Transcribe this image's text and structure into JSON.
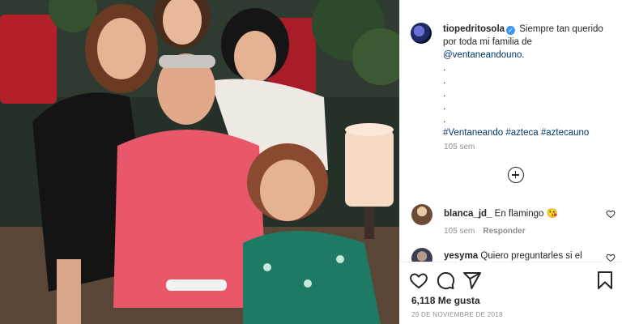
{
  "post": {
    "username": "tiopedritosola",
    "verified_mark": "✓",
    "caption_text": "Siempre tan querido por toda mi familia de",
    "mention": "@ventaneandouno.",
    "dots": [
      ".",
      ".",
      ".",
      ".",
      "."
    ],
    "hashtags": "#Ventaneando #azteca #aztecauno",
    "time_ago": "105 sem"
  },
  "comments": [
    {
      "username": "blanca_jd_",
      "text": "En flamingo 😘",
      "time_ago": "105 sem",
      "reply_label": "Responder"
    },
    {
      "username": "yesyma",
      "text": "Quiero preguntarles si el"
    }
  ],
  "actions": {
    "icons": [
      "heart-icon",
      "comment-icon",
      "share-icon",
      "bookmark-icon"
    ],
    "likes": "6,118 Me gusta",
    "date": "29 DE NOVIEMBRE DE 2018"
  },
  "colors": {
    "link": "#00376b",
    "verified": "#3897f0",
    "muted": "#8e8e8e",
    "sweater": "#e8586a"
  }
}
